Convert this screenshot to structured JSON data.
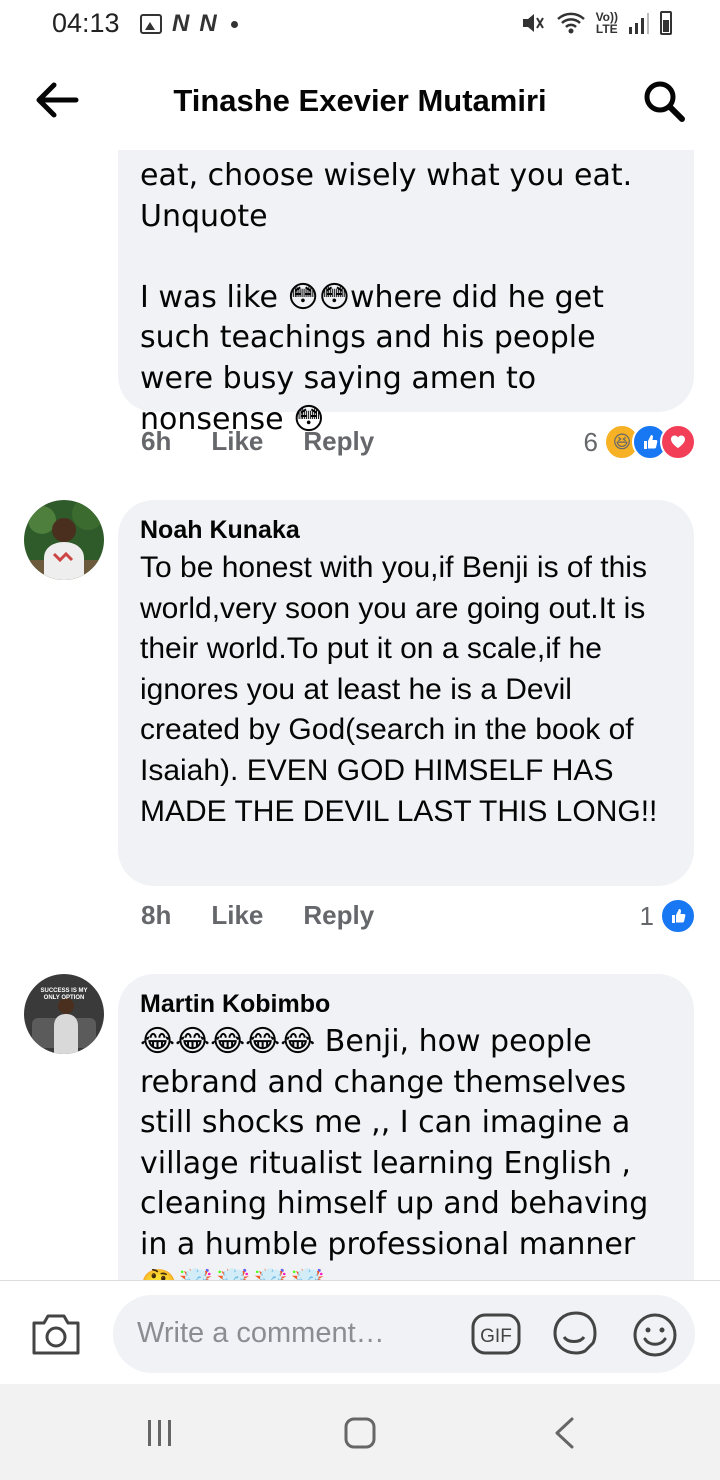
{
  "status_bar": {
    "time": "04:13",
    "network_letters": [
      "N",
      "N"
    ],
    "volte_line1": "Vo))",
    "volte_line2": "LTE"
  },
  "header": {
    "title": "Tinashe Exevier Mutamiri"
  },
  "comments": [
    {
      "text": "eat, choose wisely what you eat.\nUnquote\n\nI was like 😳😳where did he get such teachings and his people were busy saying amen to nonsense 😳",
      "time": "6h",
      "like_label": "Like",
      "reply_label": "Reply",
      "reaction_count": "6",
      "reaction_types": [
        "haha",
        "like",
        "love"
      ]
    },
    {
      "author": "Noah Kunaka",
      "text": "To be honest with you,if Benji is of this world,very soon you are going out.It is their world.To put it on a scale,if he ignores you at least he is a Devil created by God(search in the book of Isaiah). EVEN GOD HIMSELF HAS MADE THE DEVIL LAST THIS LONG!!",
      "time": "8h",
      "like_label": "Like",
      "reply_label": "Reply",
      "reaction_count": "1",
      "reaction_types": [
        "like"
      ]
    },
    {
      "author": "Martin Kobimbo",
      "avatar_text": "SUCCESS IS MY ONLY OPTION",
      "text": "😂😂😂😂😂 Benji, how people rebrand and change themselves still shocks me ,, I can imagine a village ritualist learning English , cleaning himself up and behaving in a humble professional manner 🤔🤯🤯🤯🤯"
    }
  ],
  "composer": {
    "placeholder": "Write a comment…",
    "gif_label": "GIF"
  },
  "colors": {
    "bubble": "#f0f2f5",
    "meta_text": "#65676b",
    "like_blue": "#1877f2",
    "love_red": "#f33e58",
    "haha_yellow": "#f7b125"
  }
}
